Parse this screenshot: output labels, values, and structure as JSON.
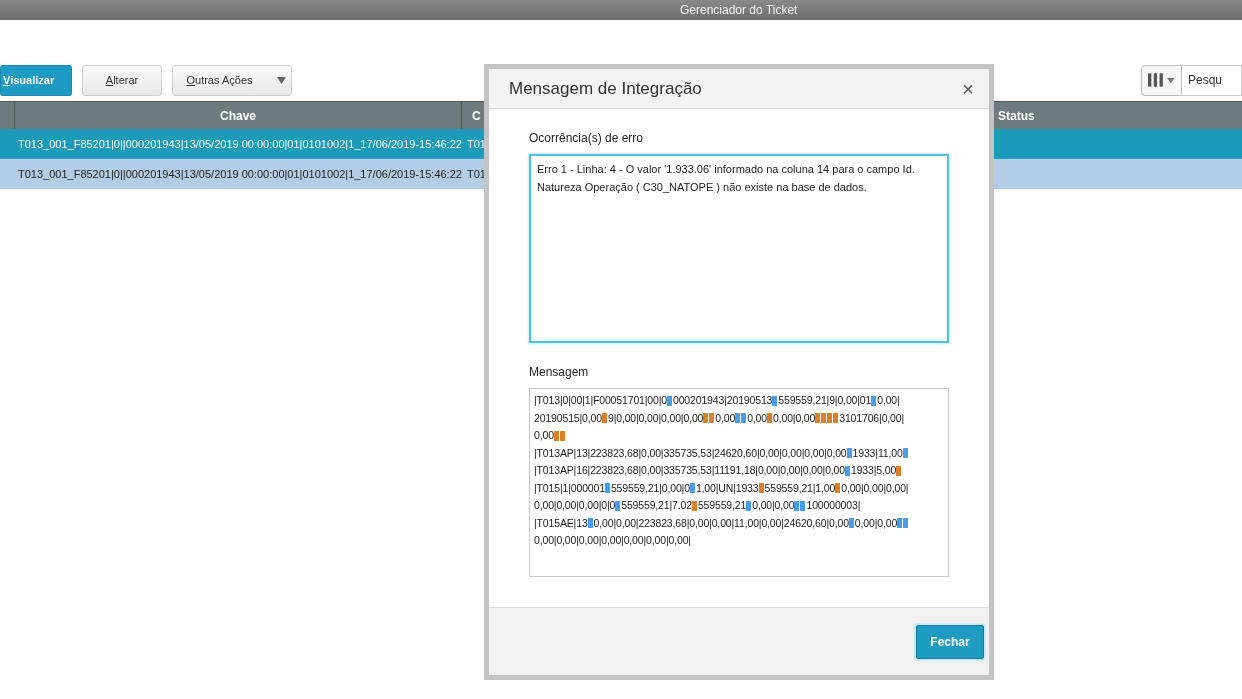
{
  "window": {
    "title": "Gerenciador do Ticket"
  },
  "toolbar": {
    "buttons": [
      {
        "label": "Visualizar",
        "kind": "primary"
      },
      {
        "label": "Alterar",
        "kind": "default"
      },
      {
        "label": "Outras Ações",
        "kind": "dropdown"
      }
    ],
    "search": {
      "placeholder": "Pesqu"
    }
  },
  "table": {
    "columns": [
      {
        "label": "Chave"
      },
      {
        "label": "C"
      },
      {
        "label": "Status"
      }
    ],
    "rows": [
      {
        "selected": true,
        "cells": [
          "T013_001_F85201|0||000201943|13/05/2019 00:00:00|01|0101002|1_17/06/2019-15:46:22",
          "T01"
        ]
      },
      {
        "selected": false,
        "cells": [
          "T013_001_F85201|0||000201943|13/05/2019 00:00:00|01|0101002|1_17/06/2019-15:46:22",
          "T01"
        ]
      }
    ]
  },
  "dialog": {
    "title": "Mensagem de Integração",
    "close": "×",
    "error_label": "Ocorrência(s) de erro",
    "error_text": "Erro 1 - Linha: 4 - O valor '1.933.06' informado na coluna 14 para o campo Id. Natureza Operação ( C30_NATOPE ) não existe na base de dados.",
    "message_label": "Mensagem",
    "message_lines": [
      [
        {
          "kind": "text",
          "text": "|T013|0|00|1|F00051701|00|0"
        },
        {
          "kind": "mark",
          "color": "#4a9ee8"
        },
        {
          "kind": "text",
          "text": "000201943|20190513"
        },
        {
          "kind": "mark",
          "color": "#4a9ee8"
        },
        {
          "kind": "text",
          "text": "559559,21|9|0,00|01"
        },
        {
          "kind": "mark",
          "color": "#4a9ee8"
        },
        {
          "kind": "text",
          "text": "0,00|"
        }
      ],
      [
        {
          "kind": "text",
          "text": "20190515|0,00"
        },
        {
          "kind": "mark",
          "color": "#d9802a"
        },
        {
          "kind": "text",
          "text": "9|0,00|0,00|0,00|0,00"
        },
        {
          "kind": "mark",
          "color": "#d9802a"
        },
        {
          "kind": "mark",
          "color": "#d9802a"
        },
        {
          "kind": "text",
          "text": "0,00"
        },
        {
          "kind": "mark",
          "color": "#4a9ee8"
        },
        {
          "kind": "mark",
          "color": "#4a9ee8"
        },
        {
          "kind": "text",
          "text": "0,00"
        },
        {
          "kind": "mark",
          "color": "#d9802a"
        },
        {
          "kind": "text",
          "text": "0,00|0,00"
        },
        {
          "kind": "mark",
          "color": "#d9802a"
        },
        {
          "kind": "mark",
          "color": "#d9802a"
        },
        {
          "kind": "mark",
          "color": "#d9802a"
        },
        {
          "kind": "mark",
          "color": "#d9802a"
        },
        {
          "kind": "text",
          "text": "3101706|0,00|"
        }
      ],
      [
        {
          "kind": "text",
          "text": "0,00"
        },
        {
          "kind": "mark",
          "color": "#d9802a"
        },
        {
          "kind": "mark",
          "color": "#d9802a"
        }
      ],
      [
        {
          "kind": "text",
          "text": "|T013AP|13|223823,68|0,00|335735,53|24620,60|0,00|0,00|0,00|0,00"
        },
        {
          "kind": "mark",
          "color": "#4a9ee8"
        },
        {
          "kind": "text",
          "text": "1933|11,00"
        },
        {
          "kind": "mark",
          "color": "#4a9ee8"
        }
      ],
      [
        {
          "kind": "text",
          "text": "|T013AP|16|223823,68|0,00|335735,53|11191,18|0,00|0,00|0,00|0,00"
        },
        {
          "kind": "mark",
          "color": "#4a9ee8"
        },
        {
          "kind": "text",
          "text": "1933|5,00"
        },
        {
          "kind": "mark",
          "color": "#d9802a"
        }
      ],
      [
        {
          "kind": "text",
          "text": "|T015|1|000001"
        },
        {
          "kind": "mark",
          "color": "#4a9ee8"
        },
        {
          "kind": "text",
          "text": "559559,21|0,00|0"
        },
        {
          "kind": "mark",
          "color": "#4a9ee8"
        },
        {
          "kind": "text",
          "text": "1,00|UN|1933"
        },
        {
          "kind": "mark",
          "color": "#d9802a"
        },
        {
          "kind": "text",
          "text": "559559,21|1,00"
        },
        {
          "kind": "mark",
          "color": "#d9802a"
        },
        {
          "kind": "text",
          "text": "0,00|0,00|0,00|"
        }
      ],
      [
        {
          "kind": "text",
          "text": "0,00|0,00|0,00|0|0"
        },
        {
          "kind": "mark",
          "color": "#4a9ee8"
        },
        {
          "kind": "text",
          "text": "559559,21|7.02"
        },
        {
          "kind": "mark",
          "color": "#d9802a"
        },
        {
          "kind": "text",
          "text": "559559,21"
        },
        {
          "kind": "mark",
          "color": "#4a9ee8"
        },
        {
          "kind": "text",
          "text": "0,00|0,00"
        },
        {
          "kind": "mark",
          "color": "#4a9ee8"
        },
        {
          "kind": "mark",
          "color": "#4a9ee8"
        },
        {
          "kind": "text",
          "text": "100000003|"
        }
      ],
      [
        {
          "kind": "text",
          "text": "|T015AE|13"
        },
        {
          "kind": "mark",
          "color": "#4a9ee8"
        },
        {
          "kind": "text",
          "text": "0,00|0,00|223823,68|0,00|0,00|11,00|0,00|24620,60|0,00"
        },
        {
          "kind": "mark",
          "color": "#4a9ee8"
        },
        {
          "kind": "text",
          "text": "0,00|0,00"
        },
        {
          "kind": "mark",
          "color": "#4a9ee8"
        },
        {
          "kind": "mark",
          "color": "#4a9ee8"
        }
      ],
      [
        {
          "kind": "text",
          "text": "0,00|0,00|0,00|0,00|0,00|0,00|0,00|"
        }
      ]
    ],
    "buttons": [
      {
        "label": "Fechar"
      }
    ]
  }
}
